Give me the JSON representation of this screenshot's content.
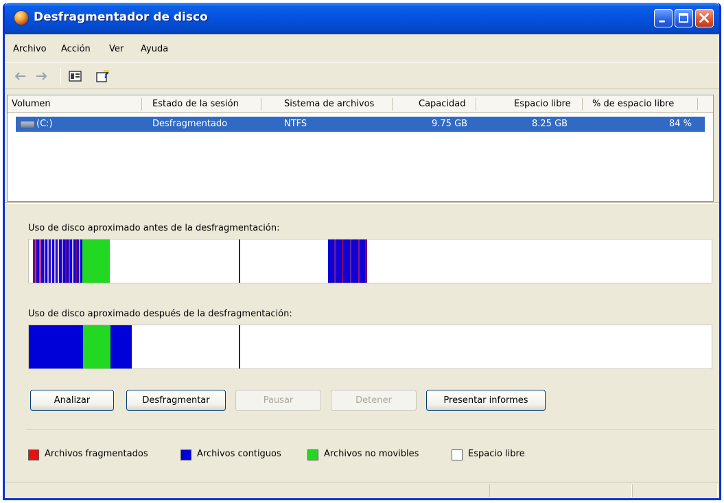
{
  "window": {
    "title": "Desfragmentador de disco"
  },
  "menu": {
    "items": [
      "Archivo",
      "Acción",
      "Ver",
      "Ayuda"
    ]
  },
  "toolbar": {
    "icons": [
      "back-arrow-icon",
      "forward-arrow-icon",
      "properties-icon",
      "help-icon"
    ]
  },
  "volume_list": {
    "columns": [
      "Volumen",
      "Estado de la sesión",
      "Sistema de archivos",
      "Capacidad",
      "Espacio libre",
      "% de espacio libre"
    ],
    "rows": [
      {
        "volume": "(C:)",
        "status": "Desfragmentado",
        "filesystem": "NTFS",
        "capacity": "9.75 GB",
        "free_space": "8.25 GB",
        "free_percent": "84 %"
      }
    ]
  },
  "analysis": {
    "before_label": "Uso de disco aproximado antes de la desfragmentación:",
    "after_label": "Uso de disco aproximado después de la desfragmentación:"
  },
  "buttons": {
    "analyze": "Analizar",
    "defragment": "Desfragmentar",
    "pause": "Pausar",
    "stop": "Detener",
    "reports": "Presentar informes"
  },
  "legend": {
    "fragmented": {
      "label": "Archivos fragmentados",
      "color": "#e81010"
    },
    "contiguous": {
      "label": "Archivos contiguos",
      "color": "#0000d8"
    },
    "unmovable": {
      "label": "Archivos no movibles",
      "color": "#22d822"
    },
    "free": {
      "label": "Espacio libre",
      "color": "#ffffff"
    }
  }
}
